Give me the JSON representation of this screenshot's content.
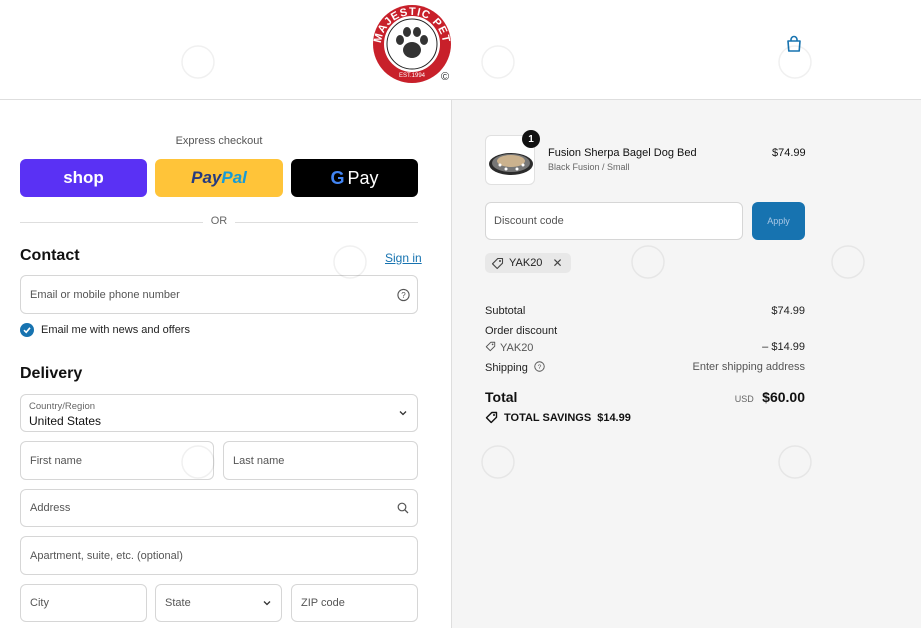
{
  "header": {
    "logo_text": "MAJESTIC PET",
    "logo_est": "EST.1994",
    "logo_mark": "©"
  },
  "express": {
    "title": "Express checkout",
    "shop_label": "shop",
    "paypal_label_1": "Pay",
    "paypal_label_2": "Pal",
    "gpay_label": "Pay",
    "or_label": "OR"
  },
  "contact": {
    "title": "Contact",
    "signin_label": "Sign in",
    "email_placeholder": "Email or mobile phone number",
    "newsletter_label": "Email me with news and offers",
    "newsletter_checked": true
  },
  "delivery": {
    "title": "Delivery",
    "country_label": "Country/Region",
    "country_value": "United States",
    "first_name_placeholder": "First name",
    "last_name_placeholder": "Last name",
    "address_placeholder": "Address",
    "apartment_placeholder": "Apartment, suite, etc. (optional)",
    "city_placeholder": "City",
    "state_placeholder": "State",
    "zip_placeholder": "ZIP code"
  },
  "order": {
    "item": {
      "quantity": "1",
      "name": "Fusion Sherpa Bagel Dog Bed",
      "variant": "Black Fusion / Small",
      "price": "$74.99"
    },
    "discount_placeholder": "Discount code",
    "apply_label": "Apply",
    "applied_code": "YAK20",
    "subtotal_label": "Subtotal",
    "subtotal_value": "$74.99",
    "order_discount_label": "Order discount",
    "order_discount_code": "YAK20",
    "order_discount_value": "– $14.99",
    "shipping_label": "Shipping",
    "shipping_value": "Enter shipping address",
    "total_label": "Total",
    "total_currency": "USD",
    "total_value": "$60.00",
    "savings_label": "TOTAL SAVINGS",
    "savings_value": "$14.99"
  },
  "colors": {
    "accent": "#1773b0",
    "shop": "#5a31f4",
    "paypal": "#ffc439",
    "gpay": "#000000",
    "panel_bg": "#f5f5f5"
  }
}
